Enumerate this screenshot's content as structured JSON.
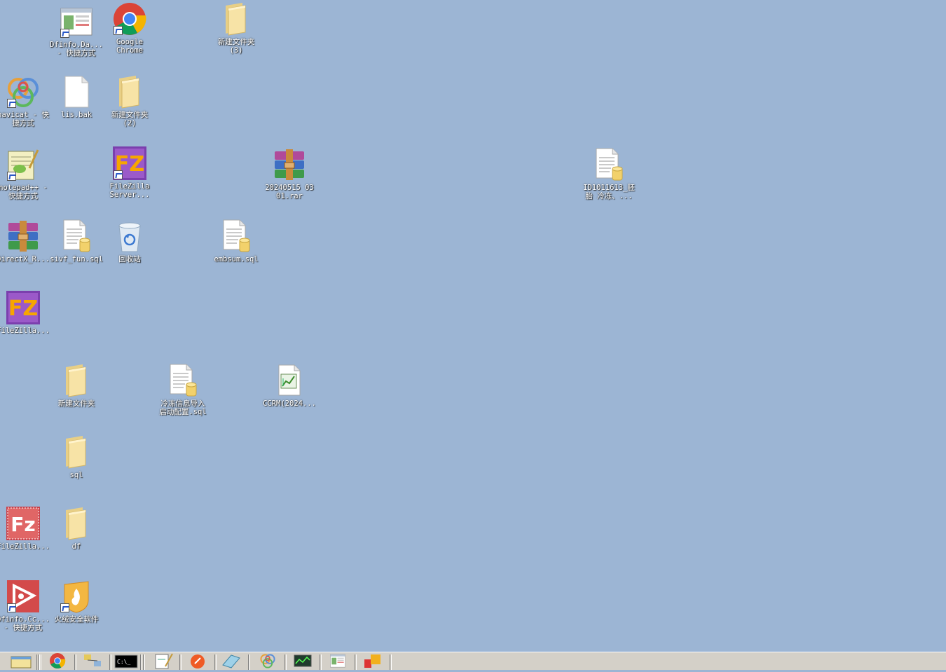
{
  "desktop": {
    "icons": [
      {
        "id": "dfinfo-da-shortcut",
        "label": "Dfinfo.Da...\n- 快捷方式",
        "icon": "app-window-icon",
        "shortcut": true
      },
      {
        "id": "google-chrome",
        "label": "Google\nChrome",
        "icon": "chrome-icon",
        "shortcut": true
      },
      {
        "id": "new-folder-3",
        "label": "新建文件夹\n(3)",
        "icon": "folder-icon",
        "shortcut": false
      },
      {
        "id": "navicat-shortcut",
        "label": "navicat - 快\n捷方式",
        "icon": "navicat-icon",
        "shortcut": true
      },
      {
        "id": "lis-bak",
        "label": "lis.bak",
        "icon": "blank-file-icon",
        "shortcut": false
      },
      {
        "id": "new-folder-2",
        "label": "新建文件夹\n(2)",
        "icon": "folder-icon",
        "shortcut": false
      },
      {
        "id": "notepadpp-shortcut",
        "label": "notepad++ -\n快捷方式",
        "icon": "notepadpp-icon",
        "shortcut": true
      },
      {
        "id": "filezilla-server-shortcut",
        "label": "FileZilla\nServer...",
        "icon": "filezilla-icon",
        "shortcut": true
      },
      {
        "id": "rar-20240515",
        "label": "20240515 03\n01.rar",
        "icon": "winrar-icon",
        "shortcut": false
      },
      {
        "id": "id1011613-file",
        "label": "ID1011613_胚\n胎 冷冻、...",
        "icon": "sql-file-icon",
        "shortcut": false
      },
      {
        "id": "directx-rar",
        "label": "DirectX_R...",
        "icon": "winrar-icon",
        "shortcut": false
      },
      {
        "id": "sivf-fun-sql",
        "label": "sivf_fun.sql",
        "icon": "sql-file-icon",
        "shortcut": false
      },
      {
        "id": "recycle-bin",
        "label": "回收站",
        "icon": "recycle-bin-icon",
        "shortcut": false
      },
      {
        "id": "embsum-sql",
        "label": "embsum.sql",
        "icon": "sql-file-icon",
        "shortcut": false
      },
      {
        "id": "filezilla-1",
        "label": "FileZilla...",
        "icon": "filezilla-icon",
        "shortcut": false
      },
      {
        "id": "new-folder",
        "label": "新建文件夹",
        "icon": "folder-icon",
        "shortcut": false
      },
      {
        "id": "freeze-import-sql",
        "label": "冷冻信息导入\n启动配置.sql",
        "icon": "sql-file-icon",
        "shortcut": false
      },
      {
        "id": "ccrm-file",
        "label": "CCRM(2024...",
        "icon": "chart-file-icon",
        "shortcut": false
      },
      {
        "id": "sql-folder",
        "label": "sql",
        "icon": "folder-icon",
        "shortcut": false
      },
      {
        "id": "filezilla-2",
        "label": "FileZilla...",
        "icon": "filezilla-red-icon",
        "shortcut": false
      },
      {
        "id": "df-folder",
        "label": "df",
        "icon": "folder-icon",
        "shortcut": false
      },
      {
        "id": "dfinfo-cc-shortcut",
        "label": "Dfinfo.Cc...\n- 快捷方式",
        "icon": "dfinfo-cc-icon",
        "shortcut": true
      },
      {
        "id": "huorong-security",
        "label": "火绒安全软件",
        "icon": "huorong-icon",
        "shortcut": true
      }
    ]
  },
  "taskbar": {
    "items": [
      {
        "id": "show-desktop",
        "icon": "show-desktop-icon"
      },
      {
        "id": "chrome",
        "icon": "chrome-icon"
      },
      {
        "id": "network-tool",
        "icon": "network-icon"
      },
      {
        "id": "cmd",
        "icon": "cmd-icon"
      },
      {
        "id": "notepad-task",
        "icon": "notepad-icon"
      },
      {
        "id": "postman",
        "icon": "postman-icon"
      },
      {
        "id": "eraser-tool",
        "icon": "eraser-icon"
      },
      {
        "id": "navicat-task",
        "icon": "navicat-icon"
      },
      {
        "id": "monitor-tool",
        "icon": "monitor-icon"
      },
      {
        "id": "app-window-task",
        "icon": "app-window-icon"
      },
      {
        "id": "shapes-tool",
        "icon": "shapes-icon"
      }
    ]
  },
  "colors": {
    "desktop_bg": "#9cb5d4",
    "taskbar_bg": "#d4d0c8",
    "label_text": "#ffffff"
  }
}
